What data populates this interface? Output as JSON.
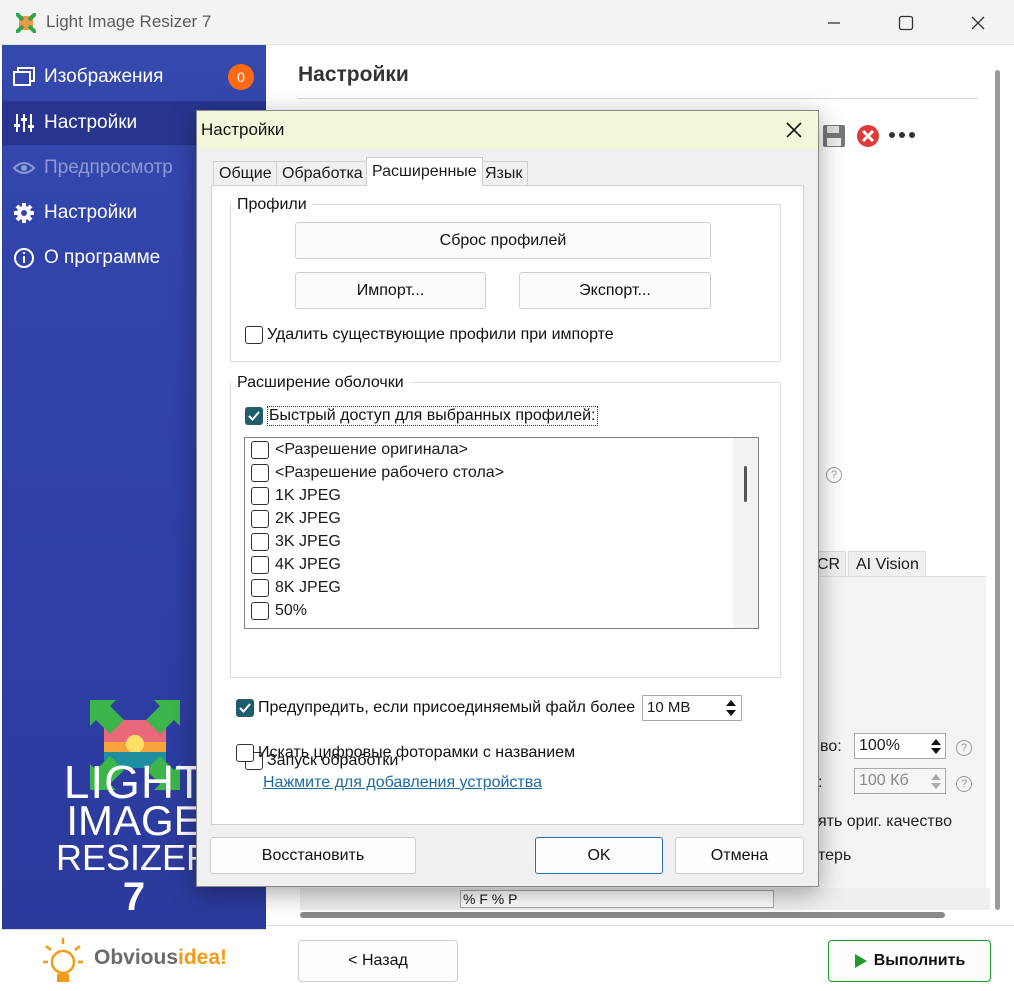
{
  "window": {
    "title": "Light Image Resizer 7"
  },
  "sidebar": {
    "items": [
      {
        "label": "Изображения",
        "badge": "0"
      },
      {
        "label": "Настройки"
      },
      {
        "label": "Предпросмотр"
      },
      {
        "label": "Настройки"
      },
      {
        "label": "О программе"
      }
    ],
    "brand": {
      "line1": "LIGHT",
      "line2": "IMAGE",
      "line3": "RESIZER",
      "line4": "7"
    },
    "footer": {
      "name_a": "Obvious",
      "name_b": "idea!"
    }
  },
  "main": {
    "title": "Настройки",
    "bg_tab_ocr": "CR",
    "bg_tab_ai": "AI Vision",
    "quality_label": "во:",
    "quality_value": "100%",
    "size_label": ":",
    "size_value": "100 Кб",
    "keep_quality": "ять ориг. качество",
    "bg_text2": "терь",
    "bg_text3": "% F  % P"
  },
  "bottom": {
    "back_label": "< Назад",
    "run_label": "Выполнить"
  },
  "dialog": {
    "title": "Настройки",
    "tabs": [
      "Общие",
      "Обработка",
      "Расширенные",
      "Язык"
    ],
    "selected_tab": "Расширенные",
    "profiles": {
      "group_label": "Профили",
      "reset_label": "Сброс профилей",
      "import_label": "Импорт...",
      "export_label": "Экспорт...",
      "delete_on_import": "Удалить существующие профили при импорте"
    },
    "shell": {
      "group_label": "Расширение оболочки",
      "quick_access": "Быстрый доступ для выбранных профилей:",
      "quick_access_checked": true,
      "list": [
        "<Разрешение оригинала>",
        "<Разрешение рабочего стола>",
        "1K JPEG",
        "2K JPEG",
        "3K JPEG",
        "4K JPEG",
        "8K JPEG",
        "50%"
      ],
      "launch_processing": "Запуск обработки"
    },
    "warn": {
      "label": "Предупредить, если присоединяемый файл более",
      "checked": true,
      "value": "10 MB"
    },
    "frames": {
      "label": "Искать цифровые фоторамки с названием",
      "link": "Нажмите для добавления устройства"
    },
    "buttons": {
      "restore": "Восстановить",
      "ok": "OK",
      "cancel": "Отмена"
    }
  },
  "colors": {
    "sidebar": "#3448ae",
    "badge": "#ff6a13",
    "checkbox_on": "#1f5c6c",
    "dialog_title_bg": "#f3f7d9",
    "run_icon": "#1e9b2c"
  }
}
